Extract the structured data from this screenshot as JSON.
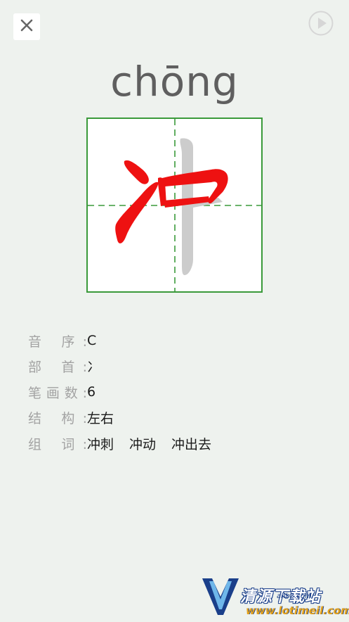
{
  "header": {
    "close_icon": "close-icon",
    "play_icon": "play-icon"
  },
  "character": {
    "pinyin": "chōng",
    "hanzi": "冲",
    "colors": {
      "written_stroke": "#ee1111",
      "pending_stroke": "#cccccc",
      "grid_border": "#3a9a3a",
      "grid_guide": "#3a9a3a"
    }
  },
  "info": {
    "rows": [
      {
        "label": "音 序:",
        "value": "C"
      },
      {
        "label": "部 首:",
        "value": "冫"
      },
      {
        "label": "笔画数:",
        "value": "6"
      },
      {
        "label": "结 构:",
        "value": "左右"
      }
    ],
    "words_label": "组 词:",
    "words": [
      "冲刺",
      "冲动",
      "冲出去"
    ]
  },
  "watermark": {
    "line1": "清源下载站",
    "line2": "ahb3.com",
    "line3": "www.lotimeil.com"
  }
}
